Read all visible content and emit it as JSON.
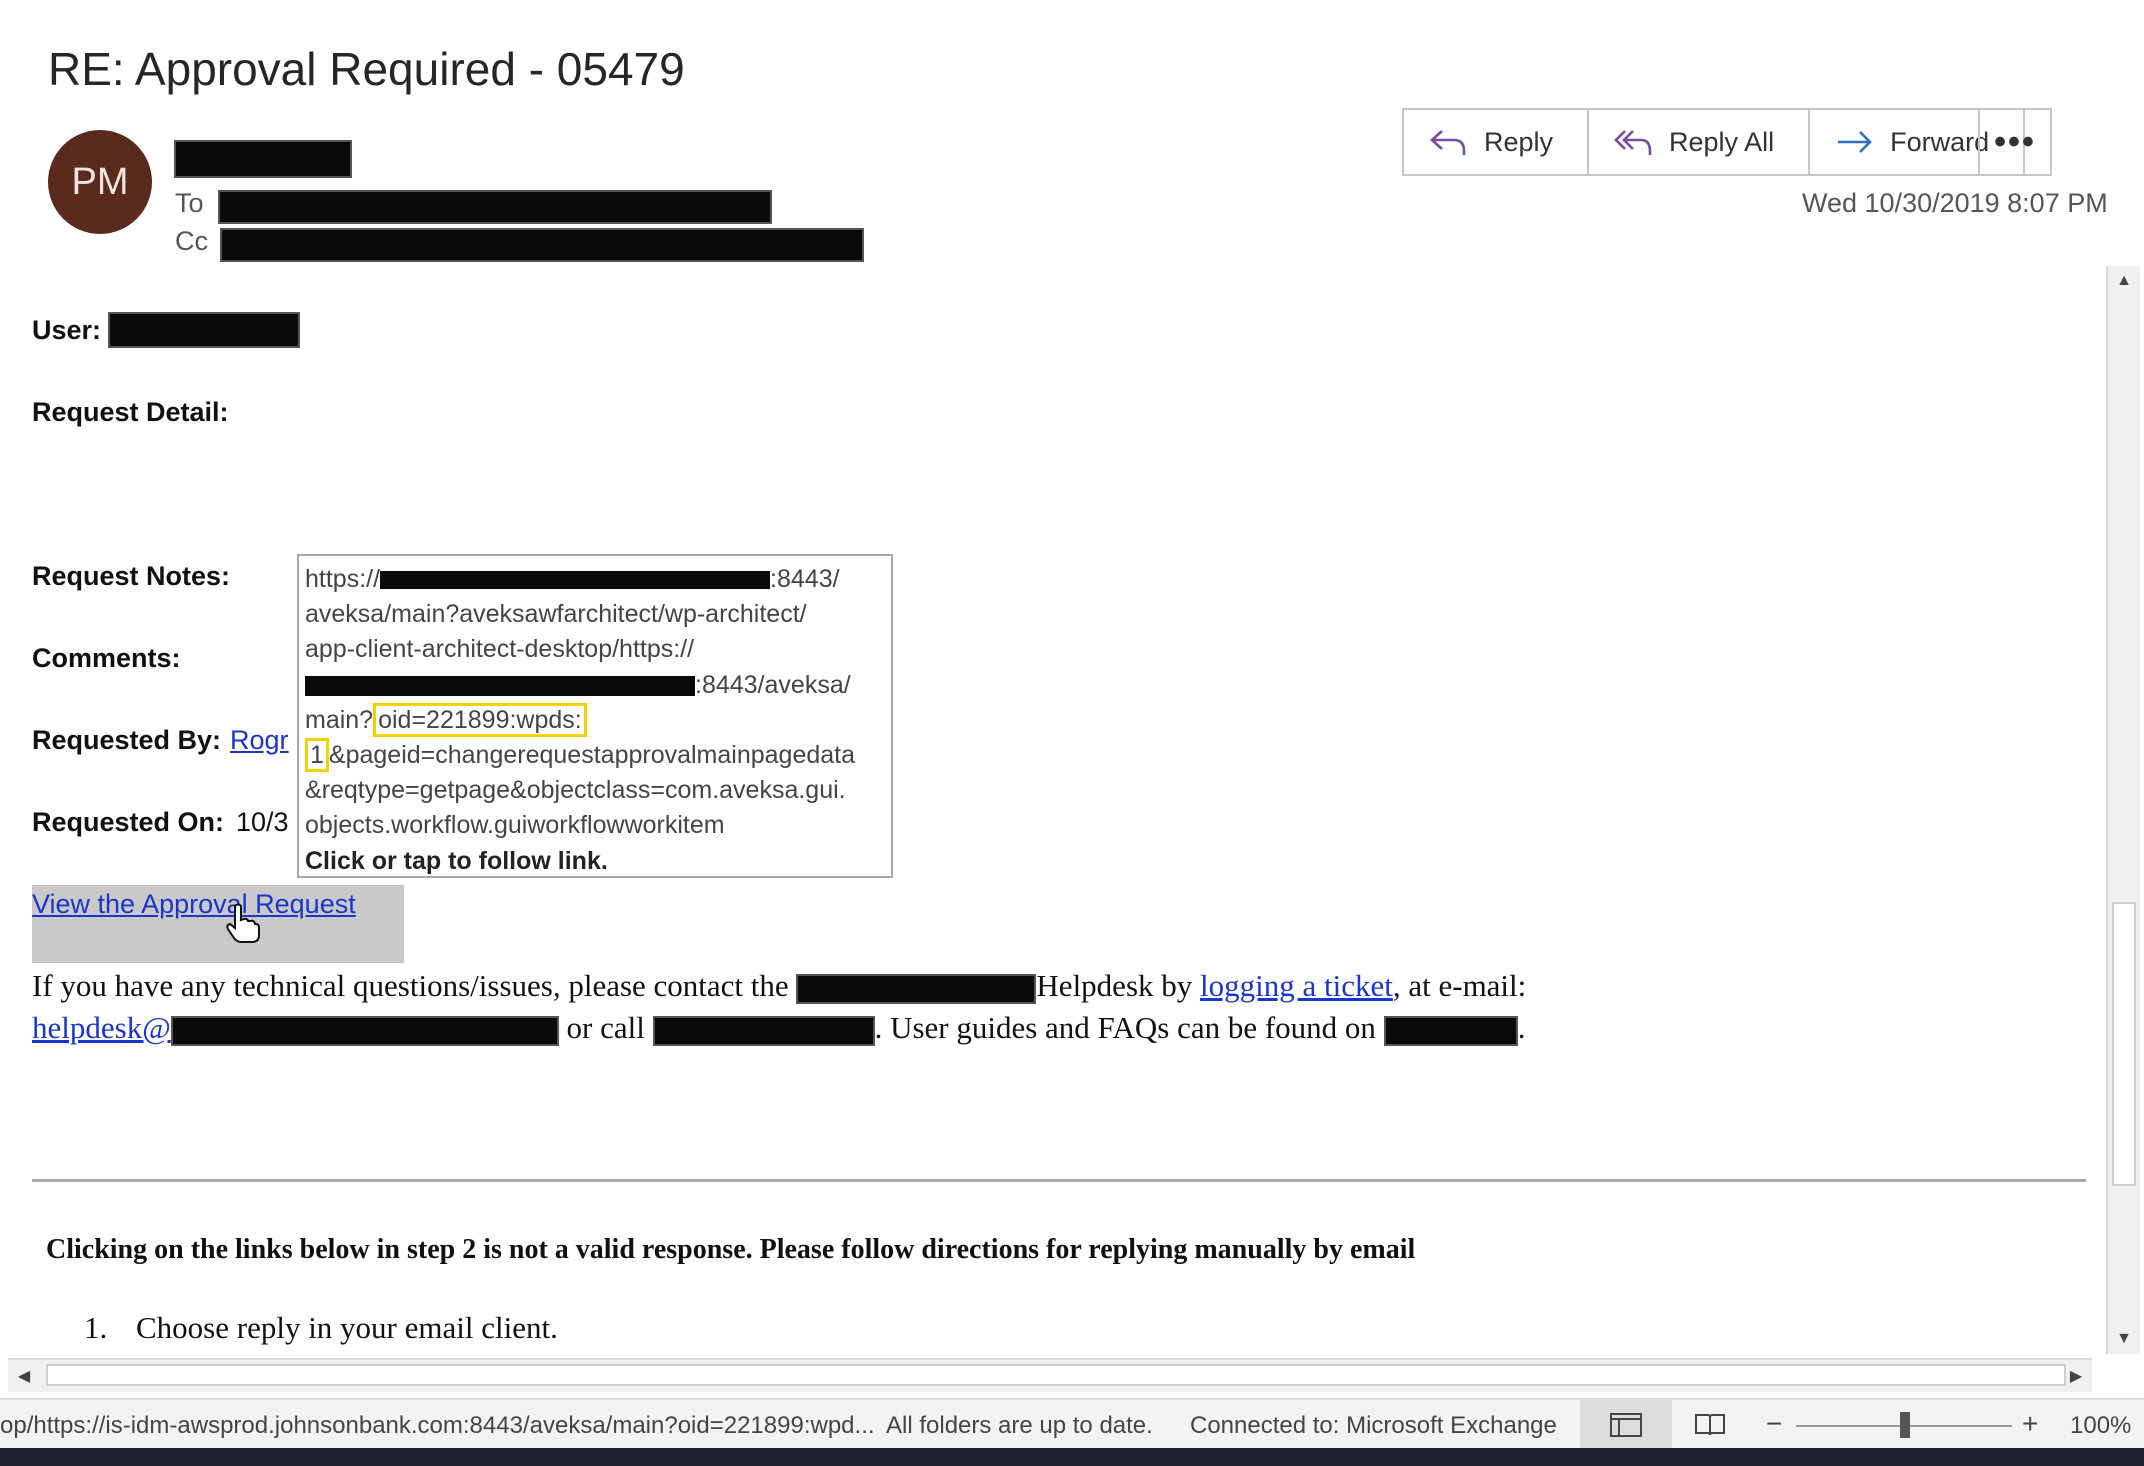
{
  "email": {
    "subject": "RE: Approval Required - 05479",
    "avatar_initials": "PM",
    "to_label": "To",
    "cc_label": "Cc",
    "date": "Wed 10/30/2019 8:07 PM"
  },
  "toolbar": {
    "reply": "Reply",
    "reply_all": "Reply All",
    "forward": "Forward",
    "more": "•••"
  },
  "body": {
    "user_label": "User:",
    "request_detail_label": "Request Detail:",
    "request_notes_label": "Request Notes:",
    "comments_label": "Comments:",
    "requested_by_label": "Requested By:",
    "requested_by_value": "Rogr",
    "requested_on_label": "Requested On:",
    "requested_on_value": "10/3",
    "view_link": "View the Approval Request",
    "help_text_1": "If you have any technical questions/issues, please contact the",
    "help_text_2": "Helpdesk by",
    "ticket_link": "logging a ticket",
    "help_text_3": ", at e-mail:",
    "helpdesk_email": "helpdesk@",
    "or_call": "or call",
    "guides_text": ". User guides and FAQs can be found on",
    "period": ".",
    "notice": "Clicking on the links below in step 2 is not a valid response. Please follow directions for replying manually by email",
    "step_number": "1.",
    "step_1": "Choose reply in your email client."
  },
  "tooltip": {
    "line1_start": "https://",
    "line1_end": ":8443/",
    "line2": "aveksa/main?aveksawfarchitect/wp-architect/",
    "line3": "app-client-architect-desktop/https://",
    "line4_end": ":8443/aveksa/",
    "line5_start": "main?",
    "line5_highlight": "oid=221899:wpds:",
    "line6_highlight": "1",
    "line6_rest": "&pageid=changerequestapprovalmainpagedata",
    "line7": "&reqtype=getpage&objectclass=com.aveksa.gui.",
    "line8": "objects.workflow.guiworkflowworkitem",
    "line9": "Click or tap to follow link."
  },
  "status_bar": {
    "url": "op/https://is-idm-awsprod.johnsonbank.com:8443/aveksa/main?oid=221899:wpd...",
    "folders": "All folders are up to date.",
    "connection": "Connected to: Microsoft Exchange",
    "zoom_minus": "−",
    "zoom_plus": "+",
    "zoom": "100%"
  }
}
